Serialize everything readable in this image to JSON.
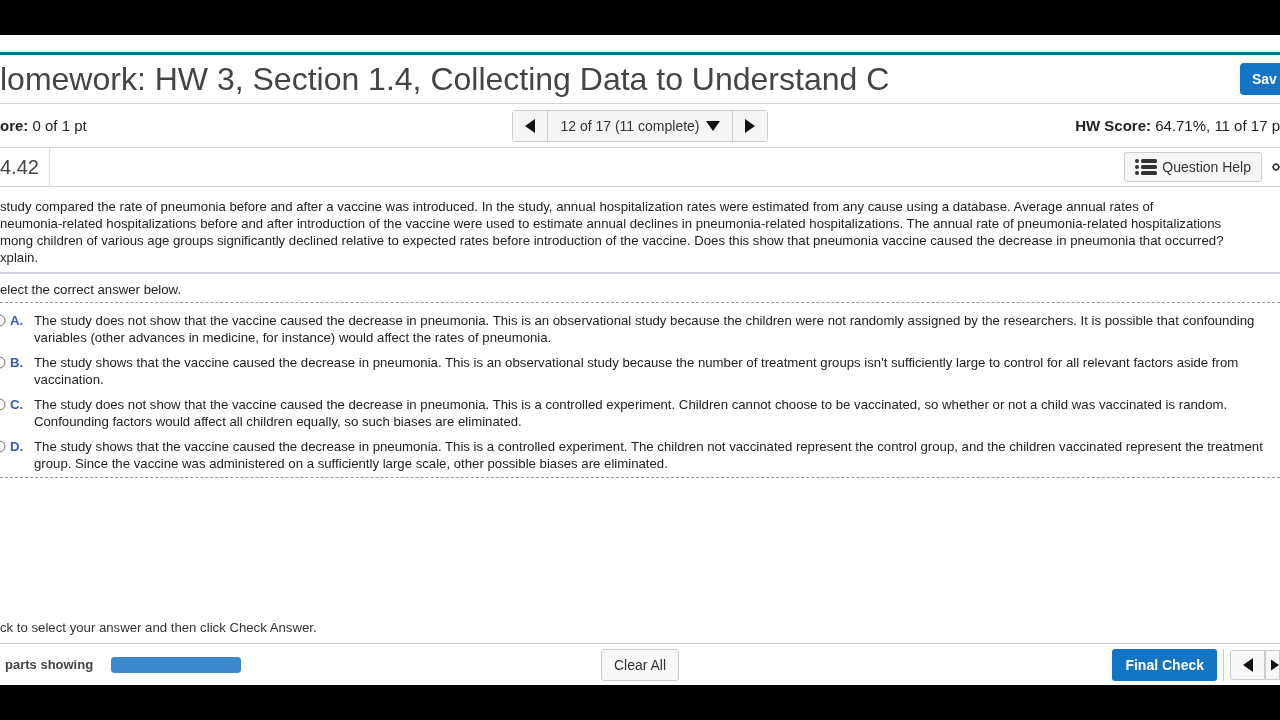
{
  "title": "lomework: HW 3, Section 1.4, Collecting Data to Understand C",
  "save_button": "Sav",
  "score": {
    "label": "ore:",
    "value": "0 of 1 pt"
  },
  "question_nav": {
    "position": "12 of 17 (11 complete)"
  },
  "hw_score": {
    "label": "HW Score:",
    "value": "64.71%, 11 of 17 p"
  },
  "question_number": "4.42",
  "question_help": "Question Help",
  "question_lines": [
    "study compared the rate of pneumonia before and after a vaccine was introduced. In the study, annual hospitalization rates were estimated from any cause using a database. Average annual rates of",
    "neumonia-related hospitalizations before and after introduction of the vaccine were used to estimate annual declines in pneumonia-related hospitalizations. The annual rate of pneumonia-related hospitalizations",
    "mong children of various age groups significantly declined relative to expected rates before introduction of the vaccine. Does this show that pneumonia vaccine caused the decrease in pneumonia that occurred?",
    "xplain."
  ],
  "prompt": "elect the correct answer below.",
  "choices": [
    {
      "letter": "A.",
      "text": "The study does not show that the vaccine caused the decrease in pneumonia. This is an observational study because the children were not randomly assigned by the researchers. It is possible that confounding variables (other advances in medicine, for instance) would affect the rates of pneumonia.",
      "selected": false
    },
    {
      "letter": "B.",
      "text": "The study shows that the vaccine caused the decrease in pneumonia. This is an observational study because the number of treatment groups isn't sufficiently large to control for all relevant factors aside from vaccination.",
      "selected": false
    },
    {
      "letter": "C.",
      "text": "The study does not show that the vaccine caused the decrease in pneumonia. This is a controlled experiment. Children cannot choose to be vaccinated, so whether or not a child was vaccinated is random. Confounding factors would affect all children equally, so such biases are eliminated.",
      "selected": false
    },
    {
      "letter": "D.",
      "text": "The study shows that the vaccine caused the decrease in pneumonia. This is a controlled experiment. The children not vaccinated represent the control group, and the children vaccinated represent the treatment group. Since the vaccine was administered on a sufficiently large scale, other possible biases are eliminated.",
      "selected": false
    }
  ],
  "instruction": "ck to select your answer and then click Check Answer.",
  "footer": {
    "parts_label": "parts showing",
    "parts_progress": {
      "level": 1
    },
    "clear_button": "Clear All",
    "final_button": "Final Check"
  }
}
